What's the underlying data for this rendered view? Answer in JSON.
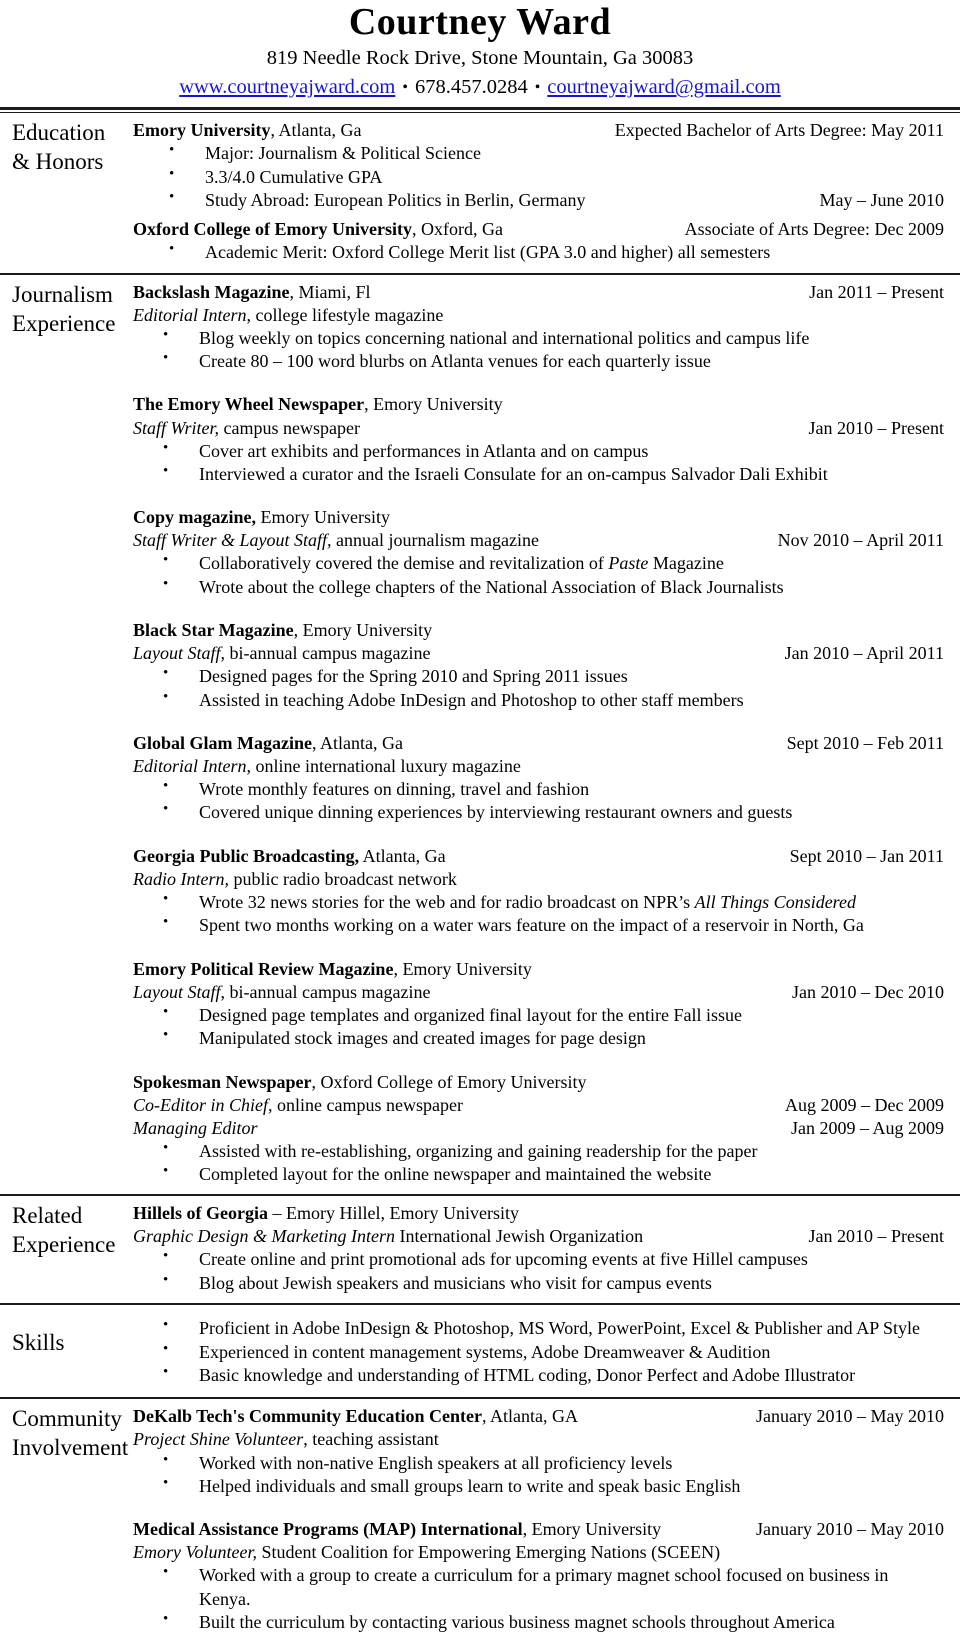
{
  "header": {
    "name": "Courtney Ward",
    "address": "819 Needle Rock Drive, Stone Mountain, Ga 30083",
    "website": "www.courtneyajward.com",
    "phone": "678.457.0284",
    "email": "courtneyajward@gmail.com",
    "separator": "•",
    "link_color": "#1515d8"
  },
  "sections": {
    "education": {
      "label_line1": "Education",
      "label_line2": "& Honors",
      "entries": [
        {
          "org": "Emory University",
          "org_rest": ", Atlanta, Ga",
          "date": "Expected Bachelor of Arts Degree: May 2011",
          "bullets": [
            "Major: Journalism & Political Science",
            "3.3/4.0 Cumulative GPA"
          ],
          "study_abroad": "Study Abroad: European Politics in Berlin, Germany",
          "study_abroad_date": "May – June 2010"
        },
        {
          "org": "Oxford College of Emory University",
          "org_rest": ", Oxford, Ga",
          "date": "Associate of Arts Degree: Dec 2009",
          "bullets": [
            "Academic Merit: Oxford College Merit list (GPA 3.0 and higher) all semesters"
          ]
        }
      ]
    },
    "journalism": {
      "label_line1": "Journalism",
      "label_line2": "Experience",
      "entries": [
        {
          "org": "Backslash Magazine",
          "org_rest": ", Miami, Fl",
          "org_date": "Jan 2011 – Present",
          "role": "Editorial Intern",
          "role_rest": ", college lifestyle magazine",
          "role_date": "",
          "bullets": [
            "Blog weekly on topics concerning national and international politics and campus life",
            "Create 80 – 100 word blurbs on Atlanta venues for each quarterly issue"
          ]
        },
        {
          "org": "The Emory Wheel Newspaper",
          "org_rest": ", Emory University",
          "org_date": "",
          "role": "Staff Writer,",
          "role_rest": " campus newspaper",
          "role_date": "Jan 2010 – Present",
          "bullets": [
            "Cover art exhibits and performances in Atlanta and on campus",
            "Interviewed a curator and the Israeli Consulate for an on-campus Salvador Dali Exhibit"
          ]
        },
        {
          "org": "Copy magazine,",
          "org_rest": " Emory University",
          "org_date": "",
          "role": "Staff Writer & Layout Staff,",
          "role_rest": " annual journalism magazine",
          "role_date": "Nov 2010 – April 2011",
          "bullets_rich": [
            {
              "pre": "Collaboratively covered the demise and revitalization of ",
              "italic": "Paste",
              "post": " Magazine"
            },
            {
              "pre": "Wrote about the college chapters of the National Association of Black Journalists",
              "italic": "",
              "post": ""
            }
          ]
        },
        {
          "org": "Black Star Magazine",
          "org_rest": ", Emory University",
          "org_date": "",
          "role": "Layout Staff,",
          "role_rest": " bi-annual campus magazine",
          "role_date": "Jan 2010 – April 2011",
          "bullets": [
            "Designed pages for the Spring 2010 and Spring 2011 issues",
            "Assisted in teaching Adobe InDesign and Photoshop to other staff members"
          ]
        },
        {
          "org": "Global Glam Magazine",
          "org_rest": ", Atlanta, Ga",
          "org_date": "Sept 2010 – Feb 2011",
          "role": "Editorial Intern,",
          "role_rest": " online international luxury magazine",
          "role_date": "",
          "bullets": [
            "Wrote monthly features on dinning, travel and fashion",
            "Covered unique dinning experiences by interviewing restaurant owners and guests"
          ]
        },
        {
          "org": "Georgia Public Broadcasting,",
          "org_rest": " Atlanta, Ga",
          "org_date": "Sept 2010 – Jan 2011",
          "role": "Radio Intern,",
          "role_rest": " public radio broadcast network",
          "role_date": "",
          "bullets_rich": [
            {
              "pre": "Wrote 32 news stories for the web and for radio broadcast on NPR’s ",
              "italic": "All Things Considered",
              "post": ""
            },
            {
              "pre": "Spent two months working on a water wars feature on the impact of a reservoir in North, Ga",
              "italic": "",
              "post": ""
            }
          ]
        },
        {
          "org": "Emory Political Review Magazine",
          "org_rest": ", Emory University",
          "org_date": "",
          "role": "Layout Staff",
          "role_rest": ", bi-annual campus magazine",
          "role_date": "Jan 2010 – Dec 2010",
          "bullets": [
            "Designed page templates and organized final layout for the entire Fall issue",
            "Manipulated stock images and created images for page design"
          ]
        },
        {
          "org": "Spokesman Newspaper",
          "org_rest": ", Oxford College of Emory University",
          "org_date": "",
          "role": "Co-Editor in Chief,",
          "role_rest": " online campus newspaper",
          "role_date": "Aug 2009 – Dec 2009",
          "role2": "Managing Editor",
          "role2_date": "Jan 2009 – Aug 2009",
          "bullets": [
            "Assisted with re-establishing, organizing and gaining readership for the paper",
            "Completed layout for the online newspaper and maintained the website"
          ]
        }
      ]
    },
    "related": {
      "label_line1": "Related",
      "label_line2": "Experience",
      "entries": [
        {
          "org": "Hillels of Georgia",
          "org_rest": " – Emory Hillel, Emory University",
          "org_date": "",
          "role": "Graphic Design & Marketing Intern",
          "role_rest": " International Jewish Organization",
          "role_date": "Jan 2010 – Present",
          "bullets": [
            "Create online and print promotional ads for upcoming events at five Hillel campuses",
            "Blog about Jewish speakers and musicians who visit for campus events"
          ]
        }
      ]
    },
    "skills": {
      "label_line1": "Skills",
      "label_line2": "",
      "bullets": [
        "Proficient in Adobe InDesign & Photoshop, MS Word, PowerPoint, Excel & Publisher and AP Style",
        "Experienced in content management systems, Adobe Dreamweaver & Audition",
        "Basic knowledge and understanding of HTML coding, Donor Perfect and Adobe Illustrator"
      ]
    },
    "community": {
      "label_line1": "Community",
      "label_line2": "Involvement",
      "entries": [
        {
          "org": "DeKalb Tech's Community Education Center",
          "org_rest": ", Atlanta, GA",
          "org_date": "January 2010 – May 2010",
          "role": "Project Shine Volunteer",
          "role_rest": ", teaching assistant",
          "role_date": "",
          "bullets": [
            "Worked with non-native English speakers at all proficiency levels",
            "Helped individuals and small groups learn to write and speak basic English"
          ]
        },
        {
          "org": "Medical Assistance Programs (MAP) International",
          "org_rest": ", Emory University",
          "org_date": "January 2010 – May 2010",
          "role": "Emory Volunteer,",
          "role_rest": " Student Coalition for Empowering Emerging Nations (SCEEN)",
          "role_date": "",
          "bullets": [
            "Worked with a group to create a curriculum for a primary magnet school focused on business in Kenya.",
            "Built the curriculum by contacting various business magnet schools throughout America"
          ]
        }
      ]
    }
  }
}
